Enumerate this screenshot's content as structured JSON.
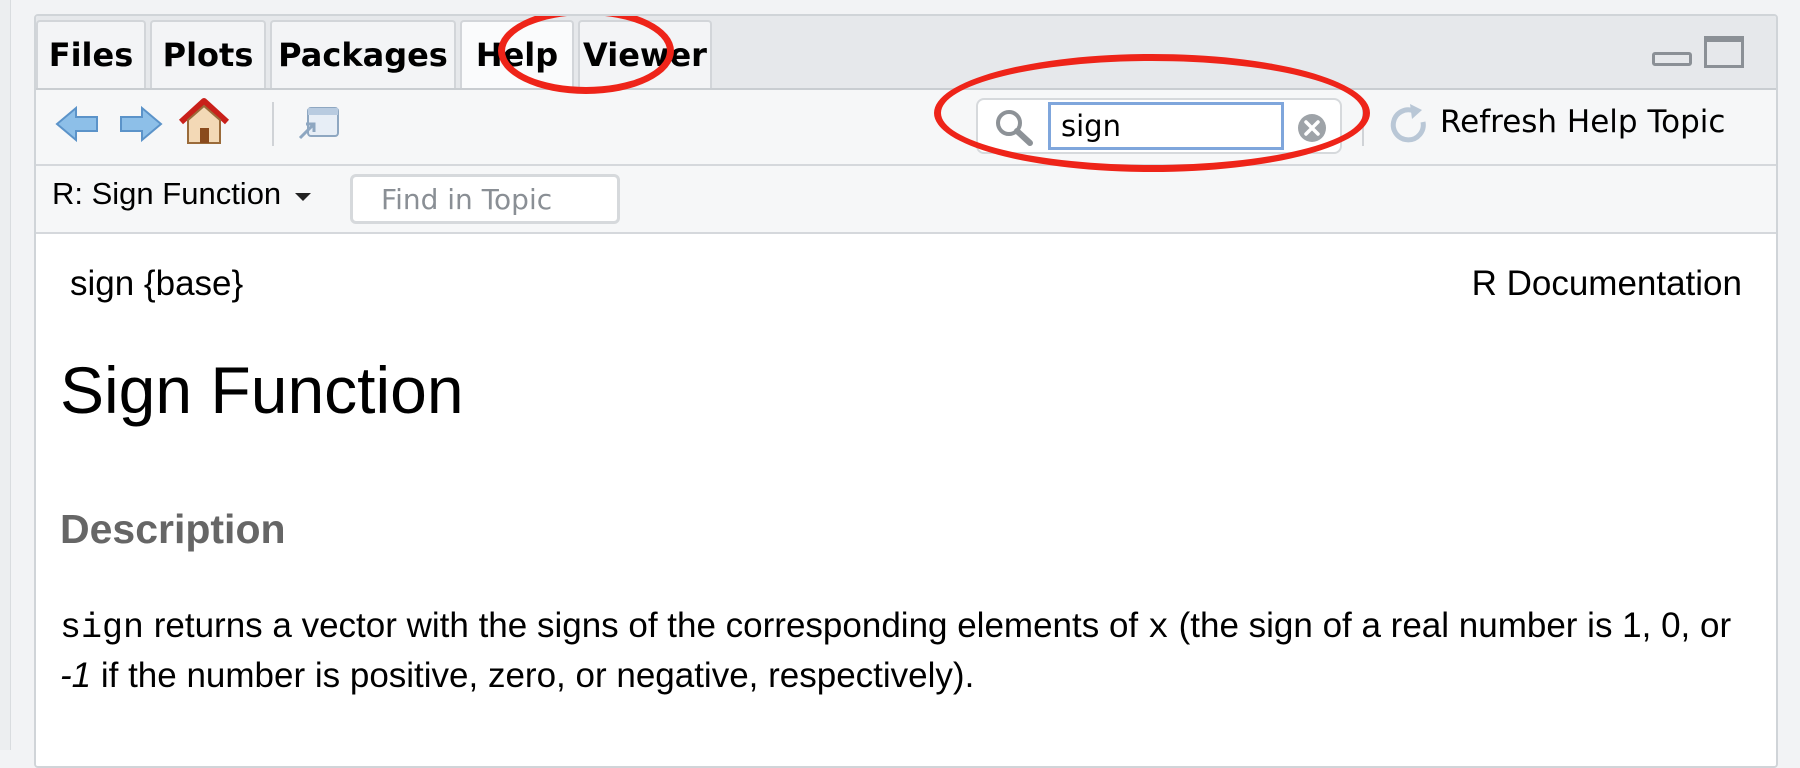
{
  "tabs": [
    {
      "label": "Files"
    },
    {
      "label": "Plots"
    },
    {
      "label": "Packages"
    },
    {
      "label": "Help"
    },
    {
      "label": "Viewer"
    }
  ],
  "active_tab": "Help",
  "search": {
    "value": "sign"
  },
  "toolbar": {
    "refresh_label": "Refresh Help Topic"
  },
  "topic": {
    "selector_label": "R: Sign Function",
    "find_placeholder": "Find in Topic"
  },
  "doc": {
    "header_left": "sign {base}",
    "header_right": "R Documentation",
    "title": "Sign Function",
    "section_description": "Description",
    "description": {
      "code1": "sign",
      "text1": " returns a vector with the signs of the corresponding elements of ",
      "code2": "x",
      "text2": " (the sign of a real number is 1, 0, or ",
      "italic": "-1",
      "text3": " if the number is positive, zero, or negative, respectively)."
    }
  },
  "icons": [
    "back-arrow-icon",
    "forward-arrow-icon",
    "home-icon",
    "popout-icon",
    "search-icon",
    "clear-icon",
    "refresh-icon",
    "minimize-icon",
    "maximize-icon"
  ],
  "colors": {
    "annotation": "#ee2419",
    "search_focus": "#7fa6dc",
    "heading_gray": "#666666"
  }
}
